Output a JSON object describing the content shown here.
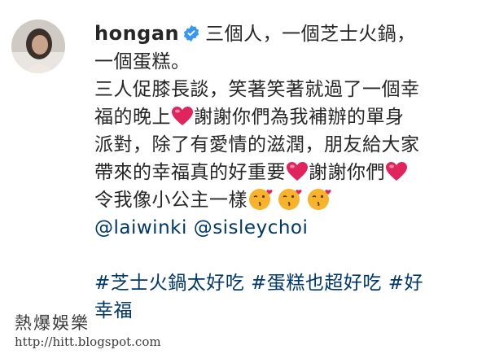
{
  "post": {
    "username": "hongan",
    "caption_lines": [
      "三個人，一個芝士火鍋，",
      "一個蛋糕。",
      "三人促膝長談，笑著笑著就過了一個幸",
      "福的晚上",
      "謝謝你們為我補辦的單身",
      "派對，除了有愛情的滋潤，朋友給大家",
      "帶來的幸福真的好重要",
      "謝謝你們",
      "令我像小公主一樣"
    ],
    "mentions": [
      "@laiwinki",
      "@sisleychoi"
    ],
    "hashtags": [
      "#芝士火鍋太好吃",
      "#蛋糕也超好吃",
      "#好",
      "幸福"
    ]
  },
  "icons": {
    "verified": "verified-badge-icon",
    "heart": "red-heart-emoji-icon",
    "kiss": "kissing-face-emoji-icon"
  },
  "colors": {
    "text": "#262626",
    "link": "#00376b",
    "verified": "#3897f0",
    "heart": "#e0245e",
    "emoji": "#f7b32b"
  },
  "watermark": {
    "title": "熱爆娛樂",
    "url": "http://hitt.blogspot.com"
  }
}
